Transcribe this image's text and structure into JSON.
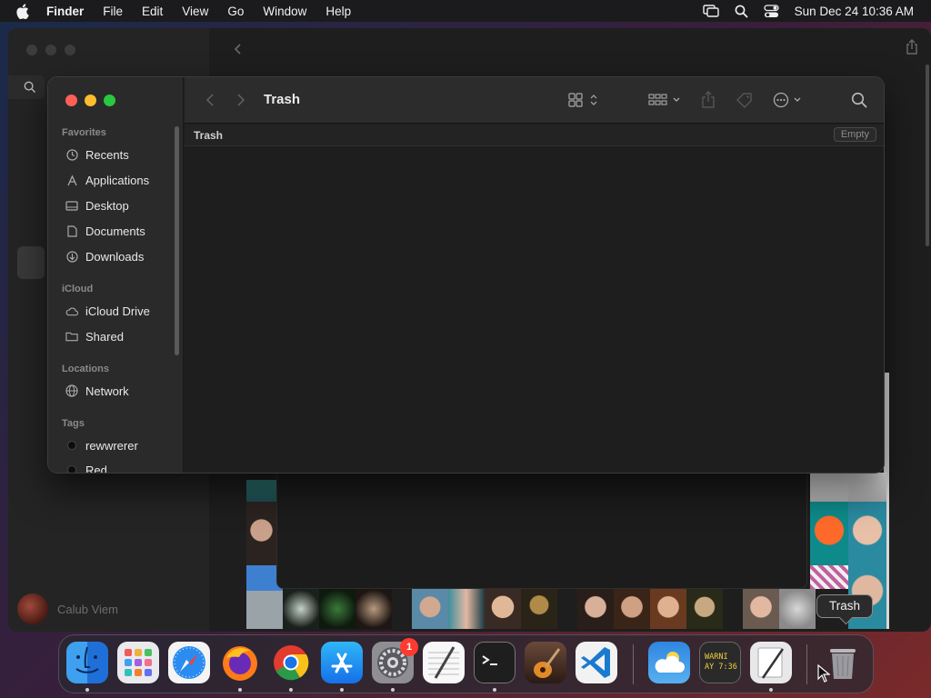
{
  "menubar": {
    "app_name": "Finder",
    "menus": [
      "File",
      "Edit",
      "View",
      "Go",
      "Window",
      "Help"
    ],
    "clock": "Sun Dec 24  10:36 AM",
    "icons": [
      "apple-icon",
      "screen-mirroring-icon",
      "spotlight-search-icon",
      "control-center-icon"
    ]
  },
  "background_window": {
    "user_name": "Calub Viem"
  },
  "finder": {
    "title": "Trash",
    "path_label": "Trash",
    "empty_button": "Empty",
    "sidebar": {
      "favorites_header": "Favorites",
      "favorites": [
        {
          "label": "Recents",
          "icon": "clock-icon"
        },
        {
          "label": "Applications",
          "icon": "applications-icon"
        },
        {
          "label": "Desktop",
          "icon": "desktop-icon"
        },
        {
          "label": "Documents",
          "icon": "document-icon"
        },
        {
          "label": "Downloads",
          "icon": "download-icon"
        }
      ],
      "icloud_header": "iCloud",
      "icloud": [
        {
          "label": "iCloud Drive",
          "icon": "cloud-icon"
        },
        {
          "label": "Shared",
          "icon": "shared-folder-icon"
        }
      ],
      "locations_header": "Locations",
      "locations": [
        {
          "label": "Network",
          "icon": "globe-icon"
        }
      ],
      "tags_header": "Tags",
      "tags": [
        {
          "label": "rewwrerer",
          "color": "#0d0d0d"
        },
        {
          "label": "Red",
          "color": "#0d0d0d"
        }
      ]
    },
    "toolbar_icons": [
      "back-icon",
      "forward-icon",
      "icon-view-icon",
      "group-icon",
      "share-icon",
      "tag-icon",
      "more-actions-icon",
      "search-icon"
    ]
  },
  "dock": {
    "apps": [
      "Finder",
      "Launchpad",
      "Safari",
      "Firefox",
      "Google Chrome",
      "App Store",
      "System Settings",
      "TextEdit",
      "Terminal",
      "GarageBand",
      "Visual Studio Code",
      "Weather",
      "Console",
      "Script Editor",
      "Trash"
    ],
    "settings_badge": "1",
    "console_text": "WARNI\nAY 7:36",
    "tooltip": "Trash"
  },
  "colors": {
    "traffic_red": "#fe5f57",
    "traffic_yellow": "#febc2e",
    "traffic_green": "#28c840",
    "badge_red": "#ff3b30"
  }
}
